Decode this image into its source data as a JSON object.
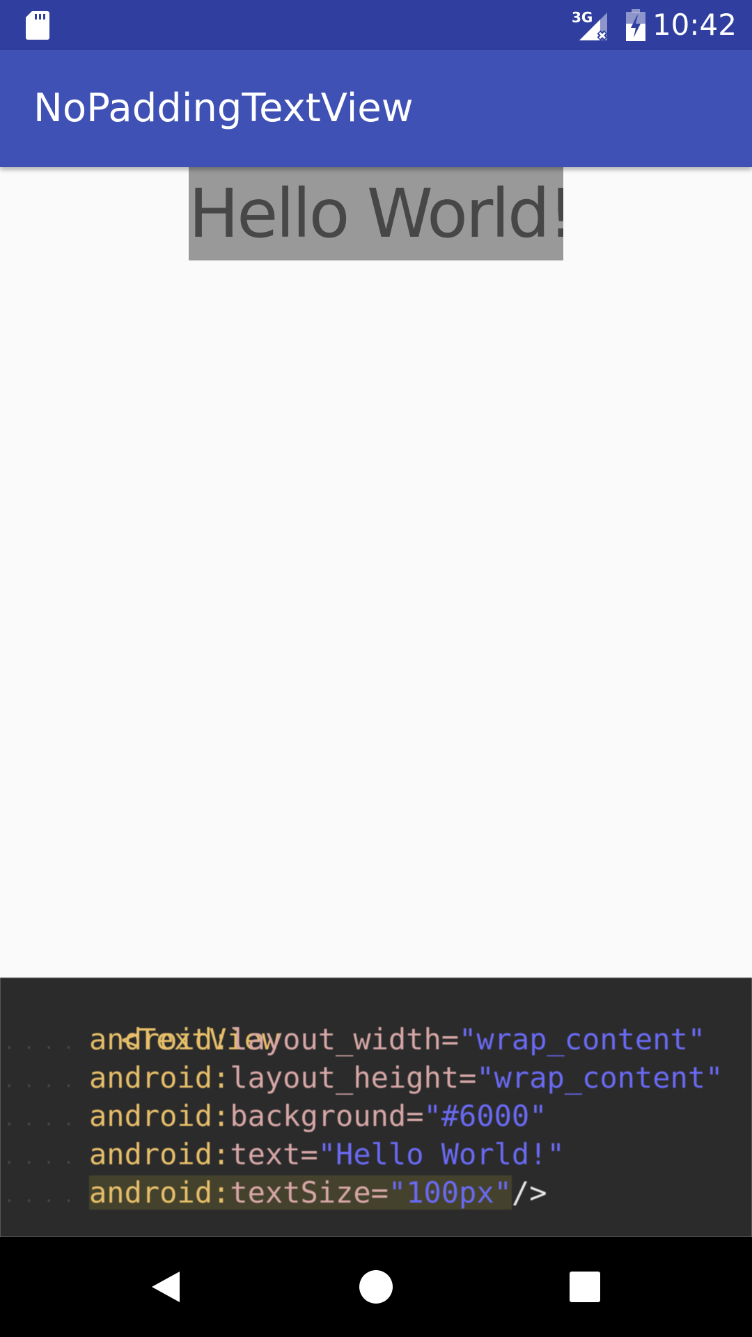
{
  "status_bar": {
    "time": "10:42",
    "network_label": "3G",
    "icons": [
      "sd-card-icon",
      "cellular-signal-icon",
      "battery-charging-icon"
    ],
    "background_color": "#303f9f"
  },
  "toolbar": {
    "title": "NoPaddingTextView",
    "background_color": "#3f51b5"
  },
  "content": {
    "hello_text": "Hello World!",
    "hello_background": "#999999"
  },
  "code": {
    "line1_tag": "<TextView",
    "line2_ns": "android",
    "line2_colon": ":",
    "line2_attr": "layout_width",
    "line2_eq": "=",
    "line2_value": "\"wrap_content\"",
    "line3_ns": "android",
    "line3_colon": ":",
    "line3_attr": "layout_height",
    "line3_eq": "=",
    "line3_value": "\"wrap_content\"",
    "line4_ns": "android",
    "line4_colon": ":",
    "line4_attr": "background",
    "line4_eq": "=",
    "line4_value": "\"#6000\"",
    "line5_ns": "android",
    "line5_colon": ":",
    "line5_attr": "text",
    "line5_eq": "=",
    "line5_value": "\"Hello World!\"",
    "line6_ns": "android",
    "line6_colon": ":",
    "line6_attr": "textSize",
    "line6_eq": "=",
    "line6_value": "\"100px\"",
    "line6_close": "/>"
  },
  "nav_bar": {
    "icons": [
      "back-icon",
      "home-icon",
      "recents-icon"
    ]
  }
}
